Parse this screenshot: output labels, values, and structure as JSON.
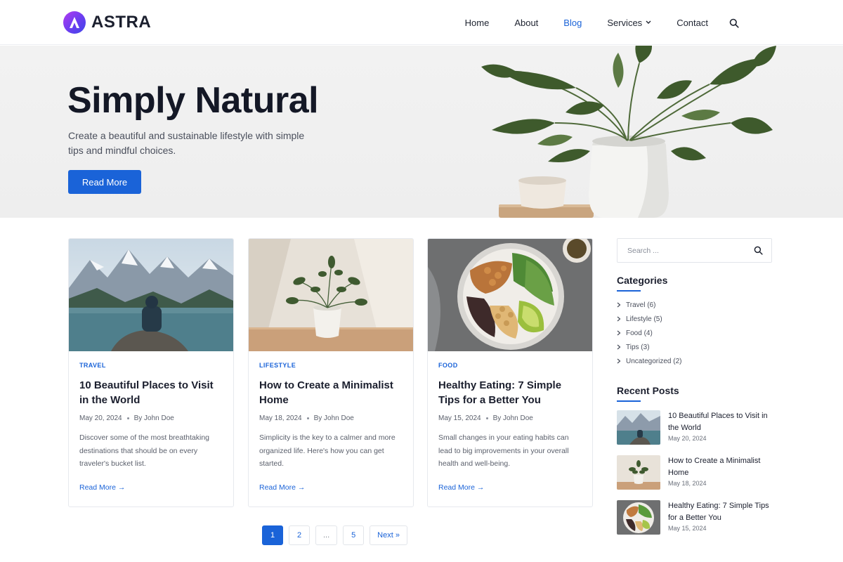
{
  "brand": {
    "name": "ASTRA",
    "accent": "#1a63d8",
    "logo_gradient": [
      "#b23cf0",
      "#3f46e8"
    ]
  },
  "nav": {
    "items": [
      {
        "label": "Home",
        "active": false
      },
      {
        "label": "About",
        "active": false
      },
      {
        "label": "Blog",
        "active": true
      },
      {
        "label": "Services",
        "active": false,
        "dropdown": true
      },
      {
        "label": "Contact",
        "active": false
      }
    ],
    "search_icon": "search-icon"
  },
  "hero": {
    "title": "Simply Natural",
    "subtitle": "Create a beautiful and sustainable lifestyle with simple tips and mindful choices.",
    "button": "Read More"
  },
  "posts": [
    {
      "category": "TRAVEL",
      "title": "10 Beautiful Places to Visit in the World",
      "date": "May 20, 2024",
      "author": "By John Doe",
      "excerpt": "Discover some of the most breathtaking destinations that should be on every traveler's bucket list.",
      "read_more": "Read More →"
    },
    {
      "category": "LIFESTYLE",
      "title": "How to Create a Minimalist Home",
      "date": "May 18, 2024",
      "author": "By John Doe",
      "excerpt": "Simplicity is the key to a calmer and more organized life. Here's how you can get started.",
      "read_more": "Read More →"
    },
    {
      "category": "FOOD",
      "title": "Healthy Eating: 7 Simple Tips for a Better You",
      "date": "May 15, 2024",
      "author": "By John Doe",
      "excerpt": "Small changes in your eating habits can lead to big improvements in your overall health and well-being.",
      "read_more": "Read More →"
    }
  ],
  "pagination": {
    "pages": [
      "1",
      "2",
      "...",
      "5"
    ],
    "current": "1",
    "next": "Next »"
  },
  "sidebar": {
    "search_placeholder": "Search ...",
    "categories_title": "Categories",
    "categories": [
      "Travel (6)",
      "Lifestyle (5)",
      "Food (4)",
      "Tips (3)",
      "Uncategorized (2)"
    ],
    "recent_title": "Recent Posts",
    "recent": [
      {
        "title": "10 Beautiful Places to Visit in the World",
        "date": "May 20, 2024"
      },
      {
        "title": "How to Create a Minimalist Home",
        "date": "May 18, 2024"
      },
      {
        "title": "Healthy Eating: 7 Simple Tips for a Better You",
        "date": "May 15, 2024"
      }
    ]
  }
}
